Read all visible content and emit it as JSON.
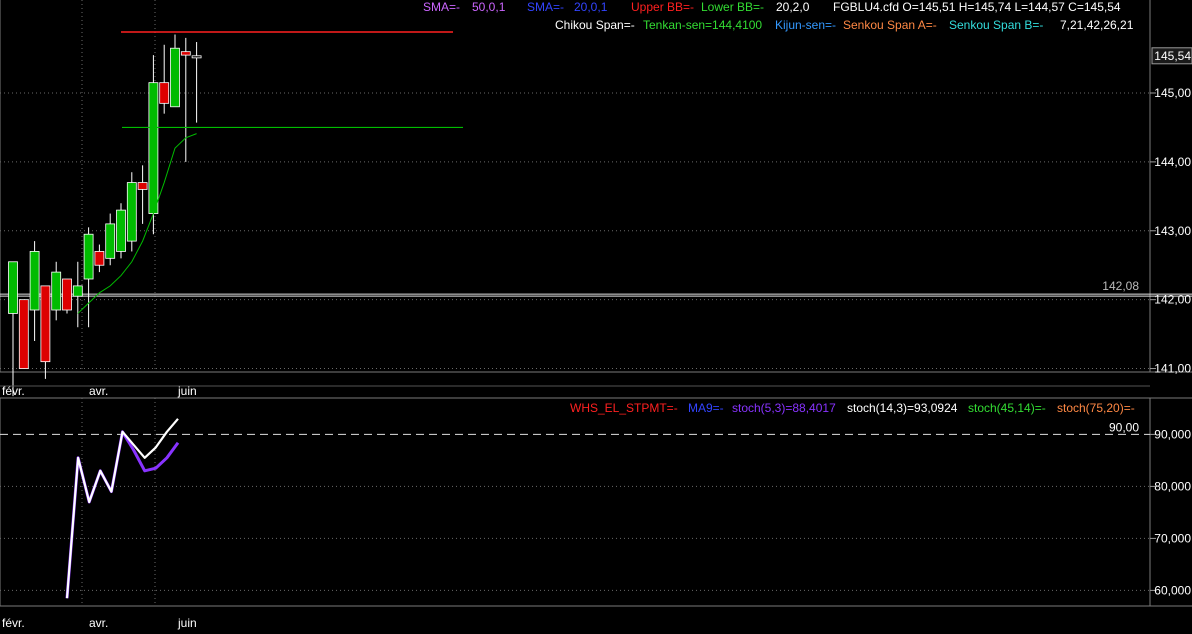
{
  "window": {
    "background": "#000000"
  },
  "price_header": {
    "line1": [
      {
        "text": "SMA=-",
        "color": "#cc66ff"
      },
      {
        "text": "50,0,1",
        "color": "#cc66ff"
      },
      {
        "text": "SMA=-",
        "color": "#3344ff"
      },
      {
        "text": "20,0,1",
        "color": "#3344ff"
      },
      {
        "text": "Upper BB=-",
        "color": "#ff2020"
      },
      {
        "text": "Lower BB=-",
        "color": "#33dd33"
      },
      {
        "text": "20,2,0",
        "color": "#ffffff"
      },
      {
        "text": "FGBLU4.cfd O=145,51 H=145,74 L=144,57 C=145,54",
        "color": "#ffffff"
      }
    ],
    "line2": [
      {
        "text": "Chikou Span=-",
        "color": "#ffffff"
      },
      {
        "text": "Tenkan-sen=144,4100",
        "color": "#33dd33"
      },
      {
        "text": "Kijun-sen=-",
        "color": "#3399ff"
      },
      {
        "text": "Senkou Span A=-",
        "color": "#ff8844"
      },
      {
        "text": "Senkou Span B=-",
        "color": "#33dddd"
      },
      {
        "text": "7,21,42,26,21",
        "color": "#ffffff"
      }
    ]
  },
  "stoch_header": [
    {
      "text": "WHS_EL_STPMT=-",
      "color": "#ff2020"
    },
    {
      "text": "MA9=-",
      "color": "#3344ff"
    },
    {
      "text": "stoch(5,3)=88,4017",
      "color": "#8833ff"
    },
    {
      "text": "stoch(14,3)=93,0924",
      "color": "#ffffff"
    },
    {
      "text": "stoch(45,14)=-",
      "color": "#33dd33"
    },
    {
      "text": "stoch(75,20)=-",
      "color": "#ff8844"
    }
  ],
  "x_axis_labels": [
    "févr.",
    "avr.",
    "juin"
  ],
  "chart_data": [
    {
      "type": "candlestick",
      "symbol": "FGBLU4.cfd",
      "ylim": [
        141.0,
        146.0
      ],
      "y_ticks": [
        "141,00",
        "142,00",
        "143,00",
        "144,00",
        "145,00"
      ],
      "last_price_label": "145,54",
      "reference_line": {
        "value": 142.08,
        "label": "142,08"
      },
      "upper_line_value": 145.74,
      "tenkan_level": 144.5,
      "colors": {
        "up": "#00bb00",
        "down": "#dd0000",
        "wick": "#ffffff",
        "tenkan": "#00bb00",
        "upper": "#ff2020"
      },
      "candles": [
        {
          "o": 141.8,
          "h": 141.7,
          "l": 140.6,
          "c": 142.55
        },
        {
          "o": 142.0,
          "h": 141.95,
          "l": 141.0,
          "c": 141.0
        },
        {
          "o": 141.85,
          "h": 142.85,
          "l": 141.4,
          "c": 142.7
        },
        {
          "o": 142.2,
          "h": 142.2,
          "l": 140.85,
          "c": 141.1
        },
        {
          "o": 141.85,
          "h": 142.55,
          "l": 141.7,
          "c": 142.4
        },
        {
          "o": 142.3,
          "h": 142.3,
          "l": 141.8,
          "c": 141.85
        },
        {
          "o": 142.05,
          "h": 142.55,
          "l": 141.6,
          "c": 142.2
        },
        {
          "o": 142.3,
          "h": 143.05,
          "l": 141.6,
          "c": 142.95
        },
        {
          "o": 142.7,
          "h": 142.8,
          "l": 142.4,
          "c": 142.5
        },
        {
          "o": 142.6,
          "h": 143.25,
          "l": 142.5,
          "c": 143.1
        },
        {
          "o": 142.7,
          "h": 143.4,
          "l": 142.6,
          "c": 143.3
        },
        {
          "o": 142.85,
          "h": 143.85,
          "l": 142.7,
          "c": 143.7
        },
        {
          "o": 143.7,
          "h": 143.95,
          "l": 143.1,
          "c": 143.6
        },
        {
          "o": 143.25,
          "h": 145.55,
          "l": 142.95,
          "c": 145.15
        },
        {
          "o": 145.15,
          "h": 145.7,
          "l": 144.7,
          "c": 144.85
        },
        {
          "o": 144.8,
          "h": 145.85,
          "l": 144.8,
          "c": 145.65
        },
        {
          "o": 145.6,
          "h": 145.8,
          "l": 144.0,
          "c": 145.55
        },
        {
          "o": 145.51,
          "h": 145.74,
          "l": 144.57,
          "c": 145.54
        }
      ],
      "tenkan_values": [
        null,
        null,
        null,
        null,
        null,
        null,
        141.8,
        141.95,
        142.1,
        142.2,
        142.35,
        142.55,
        142.85,
        143.25,
        143.7,
        144.2,
        144.35,
        144.41
      ]
    },
    {
      "type": "line",
      "ylim": [
        57.5,
        93.0
      ],
      "y_ticks": [
        "60,000",
        "70,000",
        "80,000",
        "90,000"
      ],
      "reference_line": {
        "value": 90.0,
        "label": "90,00"
      },
      "series": [
        {
          "name": "stoch(14,3)",
          "color": "#ffffff",
          "values": [
            58.5,
            85.5,
            77.0,
            83.0,
            79.0,
            90.5,
            88.0,
            85.5,
            87.5,
            90.5,
            93.0
          ]
        },
        {
          "name": "stoch(5,3)",
          "color": "#8833ff",
          "values": [
            58.5,
            85.5,
            77.0,
            83.0,
            79.0,
            90.5,
            87.0,
            83.0,
            83.5,
            85.5,
            88.4
          ]
        }
      ]
    }
  ]
}
